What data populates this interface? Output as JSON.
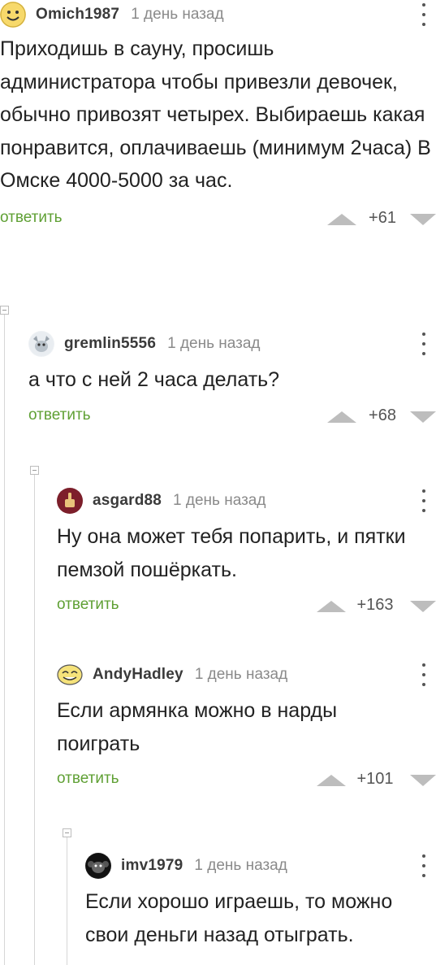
{
  "comments": [
    {
      "username": "Omich1987",
      "time": "1 день назад",
      "text": "Приходишь в сауну, просишь администратора чтобы привезли девочек, обычно привозят четырех. Выбираешь какая понравится, оплачиваешь (минимум 2часа) В Омске 4000-5000 за час.",
      "reply": "ответить",
      "rating": "+61",
      "avatar_icon": "smiley-face-icon"
    },
    {
      "username": "gremlin5556",
      "time": "1 день назад",
      "text": "а что с ней 2 часа делать?",
      "reply": "ответить",
      "rating": "+68",
      "avatar_icon": "gremlin-icon"
    },
    {
      "username": "asgard88",
      "time": "1 день назад",
      "text": "Ну она может тебя попарить, и пятки пемзой пошёркать.",
      "reply": "ответить",
      "rating": "+163",
      "avatar_icon": "fist-icon"
    },
    {
      "username": "AndyHadley",
      "time": "1 день назад",
      "text": "Если армянка можно в нарды поиграть",
      "reply": "ответить",
      "rating": "+101",
      "avatar_icon": "troll-face-icon"
    },
    {
      "username": "imv1979",
      "time": "1 день назад",
      "text": "Если хорошо играешь, то можно свои деньги назад отыграть.",
      "avatar_icon": "monkey-icon"
    }
  ],
  "colors": {
    "reply": "#5fa034",
    "vote_arrow": "#bdbdbd",
    "thread_line": "#d6d6d6"
  }
}
